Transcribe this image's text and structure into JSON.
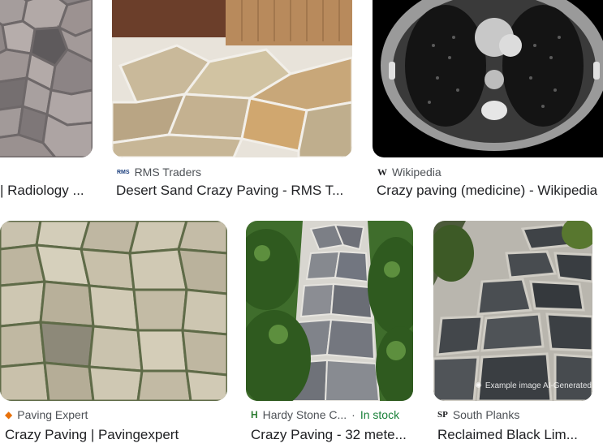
{
  "results": [
    {
      "id": "r1",
      "source": "",
      "title": "| Radiology ...",
      "favicon": ""
    },
    {
      "id": "r2",
      "source": "RMS Traders",
      "favicon": "RMS",
      "title": "Desert Sand Crazy Paving - RMS T..."
    },
    {
      "id": "r3",
      "source": "Wikipedia",
      "favicon": "W",
      "title": "Crazy paving (medicine) - Wikipedia"
    },
    {
      "id": "r4",
      "source": "Paving Expert",
      "favicon": "◆",
      "title": "Crazy Paving | Pavingexpert"
    },
    {
      "id": "r5",
      "source": "Hardy Stone C...",
      "separator": "·",
      "stock": "In stock",
      "favicon": "H",
      "title": "Crazy Paving - 32 mete..."
    },
    {
      "id": "r6",
      "source": "South Planks",
      "favicon": "SP",
      "title": "Reclaimed Black Lim...",
      "badge": "Example image AI-Generated"
    }
  ],
  "colors": {
    "stock_green": "#188038",
    "paving_expert_icon": "#e8710a",
    "hardy_icon": "#2e7d32"
  }
}
